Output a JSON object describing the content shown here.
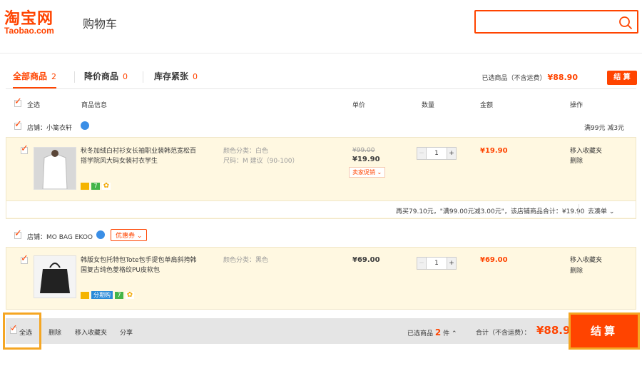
{
  "header": {
    "logo_cn": "淘宝网",
    "logo_en": "Taobao.com",
    "title": "购物车"
  },
  "tabs": [
    {
      "label": "全部商品",
      "count": "2"
    },
    {
      "label": "降价商品",
      "count": "0"
    },
    {
      "label": "库存紧张",
      "count": "0"
    }
  ],
  "selection_summary": {
    "label": "已选商品（不含运费）",
    "amount": "¥88.90",
    "checkout_label": "结 算"
  },
  "columns": {
    "select_all": "全选",
    "info": "商品信息",
    "unit_price": "单价",
    "quantity": "数量",
    "amount": "金额",
    "actions": "操作"
  },
  "shops": [
    {
      "label": "店铺：小篱衣轩",
      "promo_text": "满99元 减3元",
      "item": {
        "name": "秋冬加绒白衬衫女长袖职业装韩范宽松百搭学院风大码女装衬衣学生",
        "attr_color": "颜色分类：白色",
        "attr_size": "尺码：M 建议（90-100）",
        "old_price": "¥99.00",
        "price": "¥19.90",
        "promo_tag": "卖家促销",
        "quantity": "1",
        "subtotal": "¥19.90",
        "action_fav": "移入收藏夹",
        "action_delete": "删除"
      },
      "footer": {
        "note": "再买79.10元，\"满99.00元减3.00元\"，该店铺商品合计：¥19.90",
        "link": "去凑单"
      }
    },
    {
      "label": "店铺：MO BAG EKOO",
      "coupon": "优惠券",
      "item": {
        "name": "韩版女包托特包Tote包手提包单肩斜挎韩国复古纯色菱格纹PU皮软包",
        "attr_color": "颜色分类：黑色",
        "price": "¥69.00",
        "quantity": "1",
        "subtotal": "¥69.00",
        "badge_installment": "分期购",
        "action_fav": "移入收藏夹",
        "action_delete": "删除"
      }
    }
  ],
  "bottom_bar": {
    "select_all": "全选",
    "delete": "删除",
    "move_fav": "移入收藏夹",
    "share": "分享",
    "selected_label": "已选商品",
    "selected_count": "2",
    "selected_unit": "件",
    "total_label": "合计（不含运费）：",
    "total": "¥88.90",
    "checkout": "结算"
  },
  "colors": {
    "accent": "#ff4400",
    "highlight": "#f5a623",
    "item_bg": "#fff8e1"
  }
}
